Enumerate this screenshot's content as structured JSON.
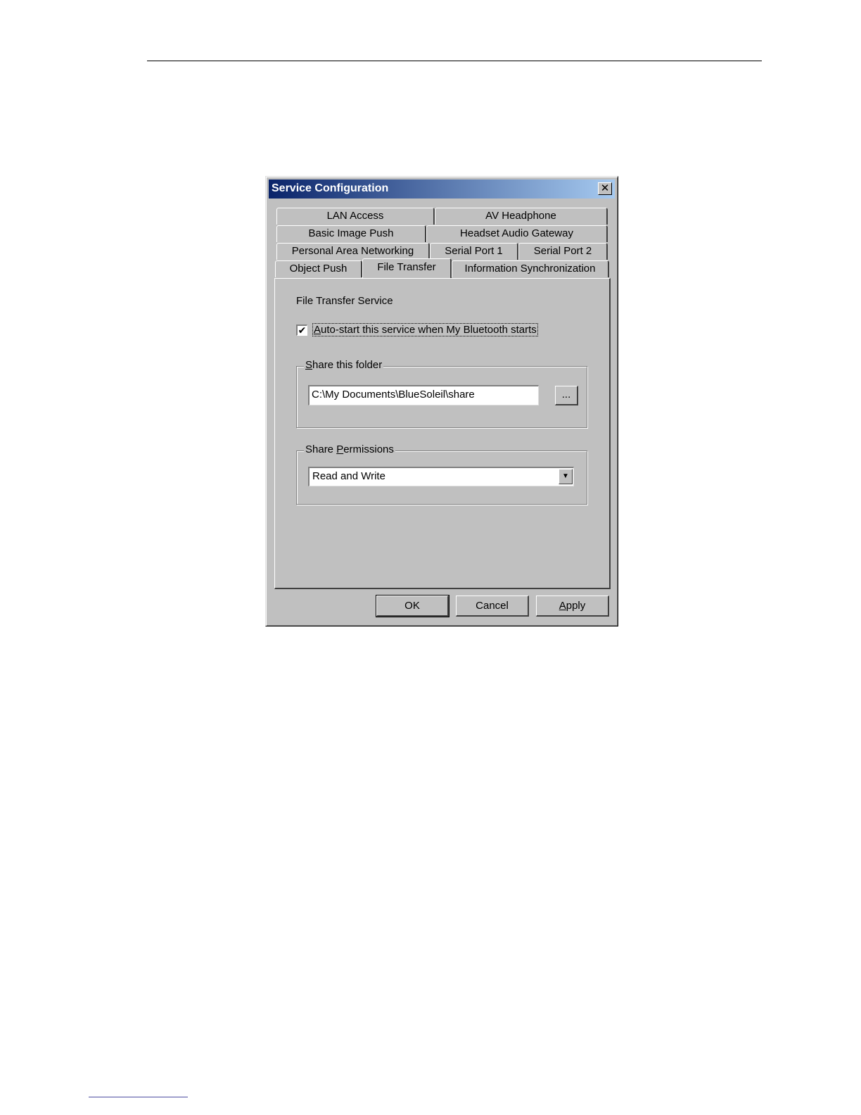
{
  "dialog": {
    "title": "Service Configuration",
    "close_glyph": "✕"
  },
  "tabs": {
    "row1": [
      "LAN Access",
      "AV Headphone"
    ],
    "row2": [
      "Basic Image Push",
      "Headset Audio Gateway"
    ],
    "row3": [
      "Personal Area Networking",
      "Serial Port 1",
      "Serial Port 2"
    ],
    "row4": [
      "Object Push",
      "File Transfer",
      "Information Synchronization"
    ],
    "active": "File Transfer"
  },
  "panel": {
    "service_title": "File Transfer Service",
    "autostart": {
      "checked": true,
      "check_glyph": "✔",
      "label_mnemonic": "A",
      "label_rest": "uto-start this service when My Bluetooth starts"
    },
    "share_folder": {
      "label_mnemonic": "S",
      "label_rest": "hare this folder",
      "path": "C:\\My Documents\\BlueSoleil\\share",
      "browse_label": "..."
    },
    "share_permissions": {
      "label_prefix": "Share ",
      "label_mnemonic": "P",
      "label_rest": "ermissions",
      "selected": "Read and Write",
      "arrow_glyph": "▼"
    }
  },
  "buttons": {
    "ok": "OK",
    "cancel": "Cancel",
    "apply_mnemonic": "A",
    "apply_rest": "pply"
  }
}
